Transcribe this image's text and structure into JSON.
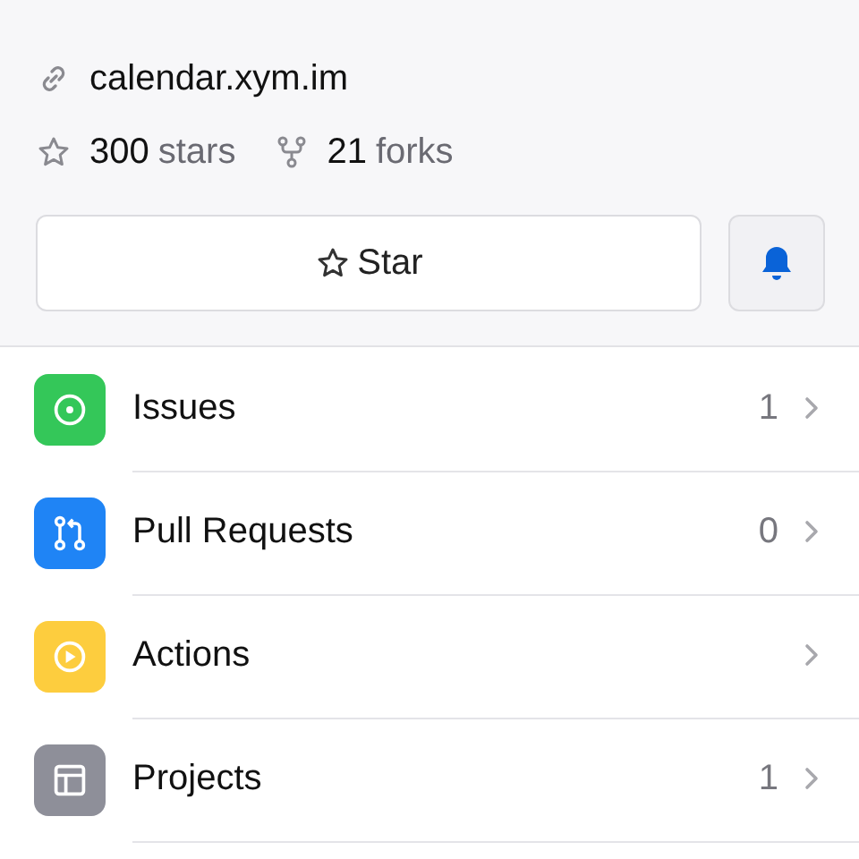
{
  "repo": {
    "website": "calendar.xym.im",
    "stars_count": "300",
    "stars_label": "stars",
    "forks_count": "21",
    "forks_label": "forks"
  },
  "actions": {
    "star_button": "Star"
  },
  "menu": [
    {
      "label": "Issues",
      "count": "1",
      "color": "#34c759"
    },
    {
      "label": "Pull Requests",
      "count": "0",
      "color": "#1f84f5"
    },
    {
      "label": "Actions",
      "color": "#fdcd3e"
    },
    {
      "label": "Projects",
      "count": "1",
      "color": "#8e8f99"
    }
  ]
}
